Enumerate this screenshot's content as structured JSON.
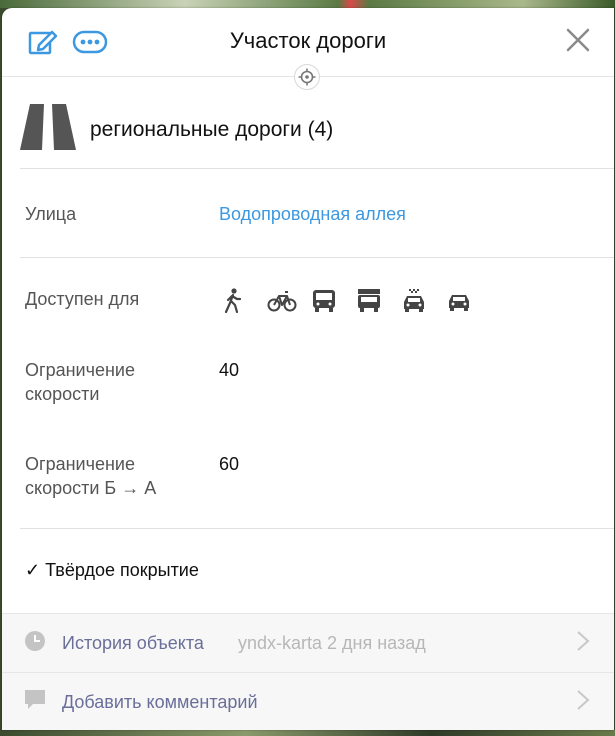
{
  "header": {
    "title": "Участок дороги",
    "icons": [
      "edit-icon",
      "more-icon",
      "close-icon",
      "target-icon"
    ]
  },
  "category": {
    "icon": "road-icon",
    "label": "региональные дороги (4)"
  },
  "street": {
    "label": "Улица",
    "value": "Водопроводная аллея"
  },
  "access": {
    "label": "Доступен для",
    "icons": [
      "pedestrian-icon",
      "bicycle-icon",
      "bus-icon",
      "truck-icon",
      "taxi-icon",
      "car-icon"
    ]
  },
  "speed_limit": {
    "label": "Ограничение скорости",
    "value": "40"
  },
  "speed_limit_reverse": {
    "label": "Ограничение скорости Б → А",
    "value": "60"
  },
  "surface": {
    "label": "✓ Твёрдое покрытие"
  },
  "history": {
    "icon": "clock-icon",
    "label": "История объекта",
    "meta": "yndx-karta 2 дня назад"
  },
  "comment": {
    "icon": "comment-icon",
    "label": "Добавить комментарий"
  },
  "colors": {
    "accent": "#3c98e0",
    "footer_text": "#6a6f9a",
    "muted": "#b7b7b7"
  }
}
